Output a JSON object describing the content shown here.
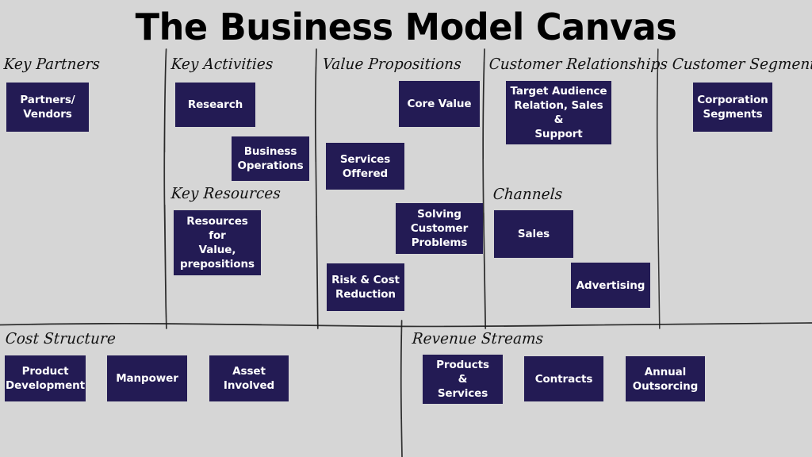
{
  "title": "The Business Model Canvas",
  "theme": {
    "background": "#d6d6d6",
    "box_fill": "#231b54",
    "box_text": "#ffffff",
    "heading_text": "#111111",
    "divider": "#1a1a1a"
  },
  "sections": {
    "key_partners": {
      "heading": "Key Partners",
      "cards": [
        {
          "label": "Partners/\nVendors"
        }
      ]
    },
    "key_activities": {
      "heading": "Key Activities",
      "cards": [
        {
          "label": "Research"
        },
        {
          "label": "Business\nOperations"
        }
      ]
    },
    "key_resources": {
      "heading": "Key Resources",
      "cards": [
        {
          "label": "Resources for\nValue,\nprepositions"
        }
      ]
    },
    "value_propositions": {
      "heading": "Value Propositions",
      "cards": [
        {
          "label": "Core Value"
        },
        {
          "label": "Services\nOffered"
        },
        {
          "label": "Solving\nCustomer\nProblems"
        },
        {
          "label": "Risk & Cost\nReduction"
        }
      ]
    },
    "customer_relationships": {
      "heading": "Customer Relationships",
      "cards": [
        {
          "label": "Target Audience\nRelation, Sales &\nSupport"
        }
      ]
    },
    "channels": {
      "heading": "Channels",
      "cards": [
        {
          "label": "Sales"
        },
        {
          "label": "Advertising"
        }
      ]
    },
    "customer_segments": {
      "heading": "Customer Segments",
      "cards": [
        {
          "label": "Corporation\nSegments"
        }
      ]
    },
    "cost_structure": {
      "heading": "Cost Structure",
      "cards": [
        {
          "label": "Product\nDevelopment"
        },
        {
          "label": "Manpower"
        },
        {
          "label": "Asset\nInvolved"
        }
      ]
    },
    "revenue_streams": {
      "heading": "Revenue Streams",
      "cards": [
        {
          "label": "Products\n&\nServices"
        },
        {
          "label": "Contracts"
        },
        {
          "label": "Annual\nOutsorcing"
        }
      ]
    }
  }
}
